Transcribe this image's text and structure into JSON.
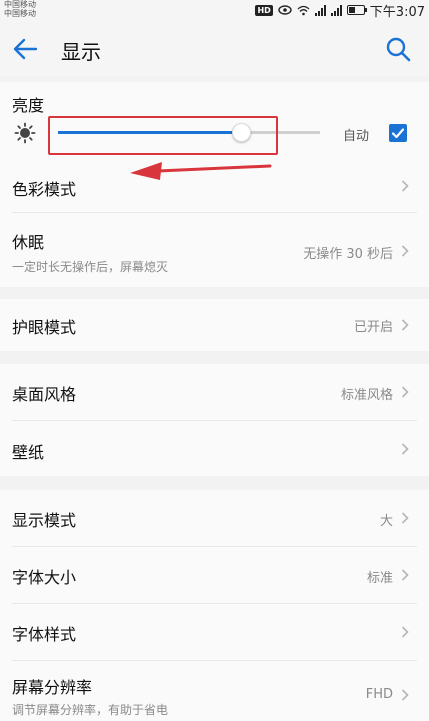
{
  "status_bar": {
    "carrier_1": "中国移动",
    "carrier_2": "中国移动",
    "badge": "HD",
    "time": "下午3:07",
    "icons": [
      "hd-badge-icon",
      "eye-icon",
      "wifi-icon",
      "signal-icon",
      "signal-icon",
      "battery-icon"
    ]
  },
  "app_bar": {
    "title": "显示",
    "back_icon": "back-arrow-icon",
    "search_icon": "search-icon"
  },
  "brightness": {
    "label": "亮度",
    "level_fraction": 0.7,
    "auto_label": "自动",
    "auto_checked": true,
    "icon": "brightness-sun-icon"
  },
  "annotation": {
    "box_color": "#d8363c",
    "arrow_color": "#d8363c"
  },
  "items": [
    {
      "key": "color_mode",
      "label": "色彩模式",
      "value": ""
    },
    {
      "key": "sleep",
      "label": "休眠",
      "sub": "一定时长无操作后，屏幕熄灭",
      "value": "无操作 30 秒后"
    },
    {
      "key": "eye_comfort",
      "label": "护眼模式",
      "value": "已开启"
    },
    {
      "key": "home_style",
      "label": "桌面风格",
      "value": "标准风格"
    },
    {
      "key": "wallpaper",
      "label": "壁纸",
      "value": ""
    },
    {
      "key": "display_mode",
      "label": "显示模式",
      "value": "大"
    },
    {
      "key": "font_size",
      "label": "字体大小",
      "value": "标准"
    },
    {
      "key": "font_style",
      "label": "字体样式",
      "value": ""
    },
    {
      "key": "resolution",
      "label": "屏幕分辨率",
      "sub": "调节屏幕分辨率，有助于省电",
      "value": "FHD"
    }
  ],
  "colors": {
    "accent": "#1a73d4",
    "background": "#f2f2f2",
    "card": "#fafafa"
  }
}
